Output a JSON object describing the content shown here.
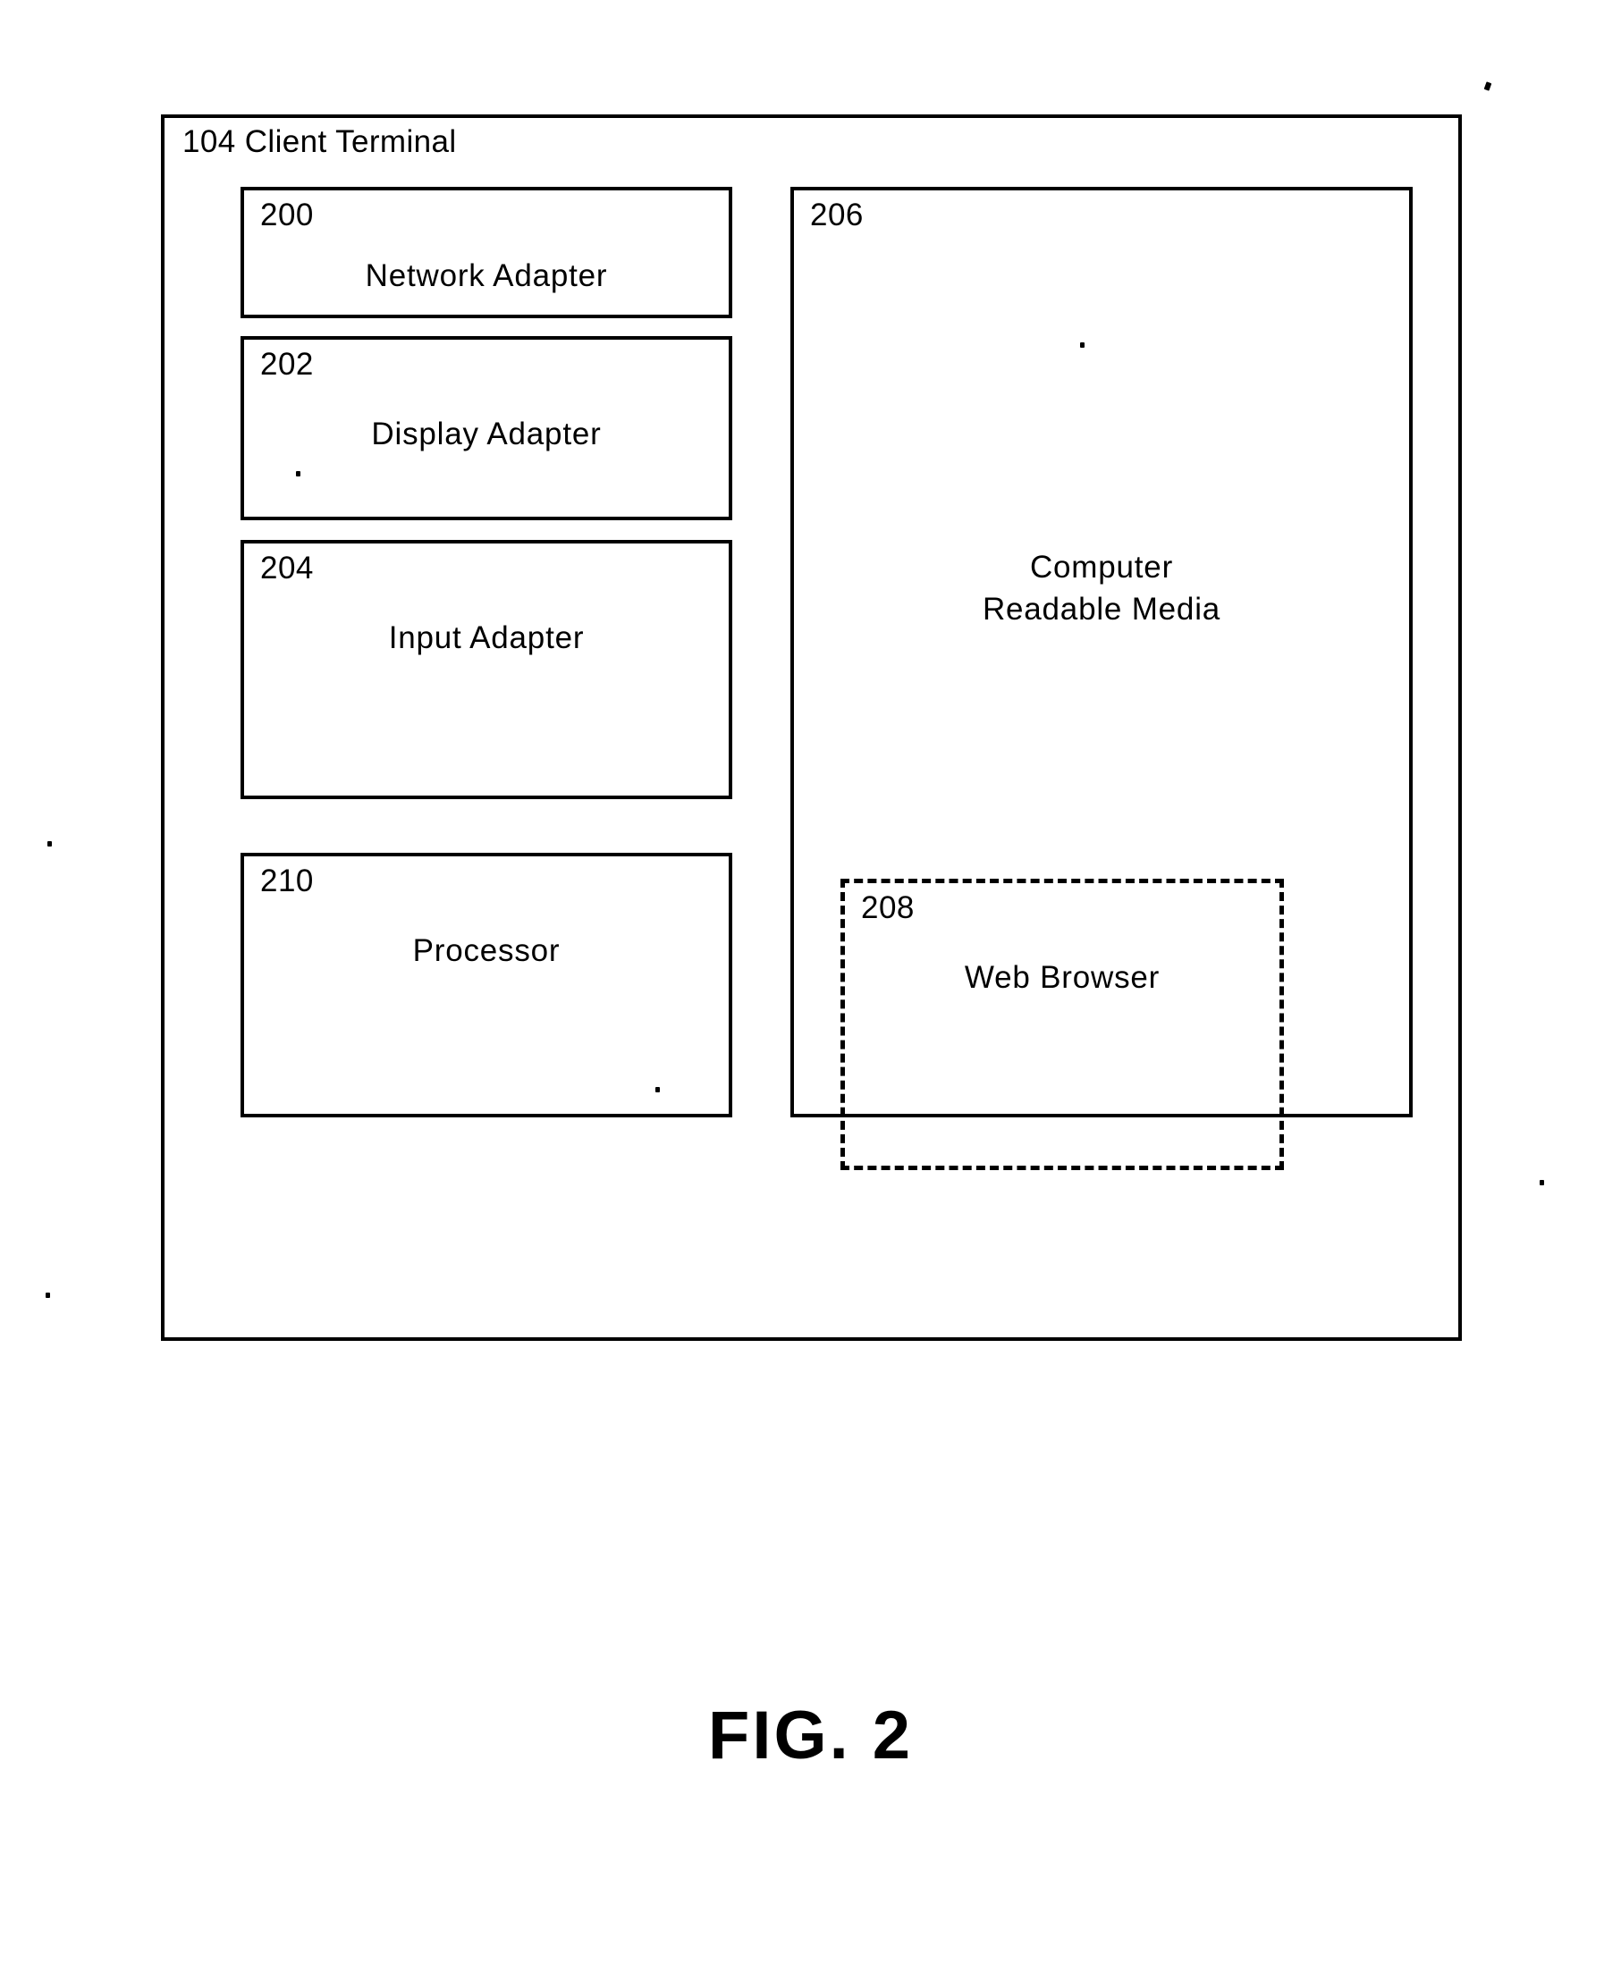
{
  "figure": {
    "caption": "FIG. 2"
  },
  "diagram": {
    "outer": {
      "ref": "104",
      "title": "104 Client Terminal",
      "name": "client-terminal"
    },
    "left_column": [
      {
        "ref": "200",
        "label": "Network Adapter",
        "name": "network-adapter"
      },
      {
        "ref": "202",
        "label": "Display Adapter",
        "name": "display-adapter"
      },
      {
        "ref": "204",
        "label": "Input Adapter",
        "name": "input-adapter"
      },
      {
        "ref": "210",
        "label": "Processor",
        "name": "processor"
      }
    ],
    "right_column": [
      {
        "ref": "206",
        "label_line1": "Computer",
        "label_line2": "Readable Media",
        "name": "computer-readable-media"
      }
    ],
    "nested": [
      {
        "ref": "208",
        "label": "Web Browser",
        "name": "web-browser",
        "border": "dashed"
      }
    ]
  }
}
